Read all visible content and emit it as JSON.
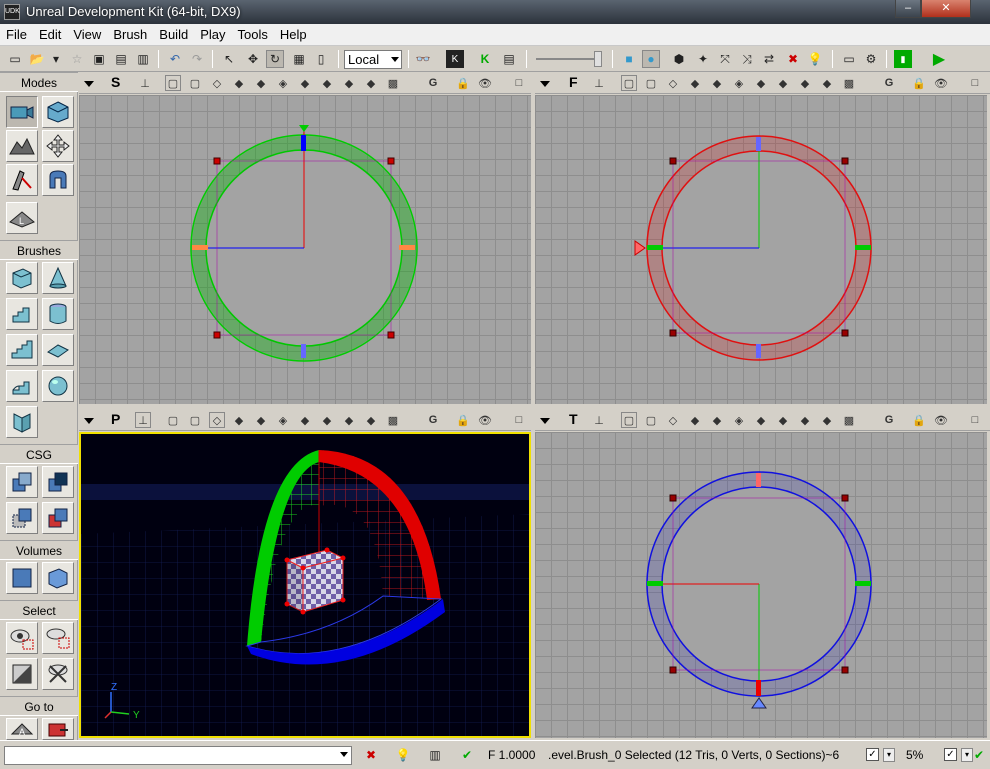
{
  "window": {
    "title": "Unreal Development Kit (64-bit, DX9)",
    "app_icon_label": "UDK"
  },
  "menu": [
    "File",
    "Edit",
    "View",
    "Brush",
    "Build",
    "Play",
    "Tools",
    "Help"
  ],
  "toolbar": {
    "coord_space": "Local"
  },
  "left_panel": {
    "sections": [
      "Modes",
      "Brushes",
      "CSG",
      "Volumes",
      "Select",
      "Go to"
    ]
  },
  "viewports": [
    {
      "id": "side",
      "letter": "S",
      "type": "orthographic",
      "wire_color": "#00cc00"
    },
    {
      "id": "front",
      "letter": "F",
      "type": "orthographic",
      "wire_color": "#e01010"
    },
    {
      "id": "perspective",
      "letter": "P",
      "type": "perspective"
    },
    {
      "id": "top",
      "letter": "T",
      "type": "orthographic",
      "wire_color": "#1010e0"
    }
  ],
  "status": {
    "drag_grid": "F 1.0000",
    "selection": ".evel.Brush_0 Selected (12 Tris, 0 Verts, 0 Sections)~6",
    "zoom": "5%",
    "axis_z": "Z",
    "axis_y": "Y"
  },
  "colors": {
    "accent": "#00aa00",
    "viewport_bg": "#a3a3a3",
    "persp_bg": "#000010",
    "active_border": "#f0e000"
  }
}
